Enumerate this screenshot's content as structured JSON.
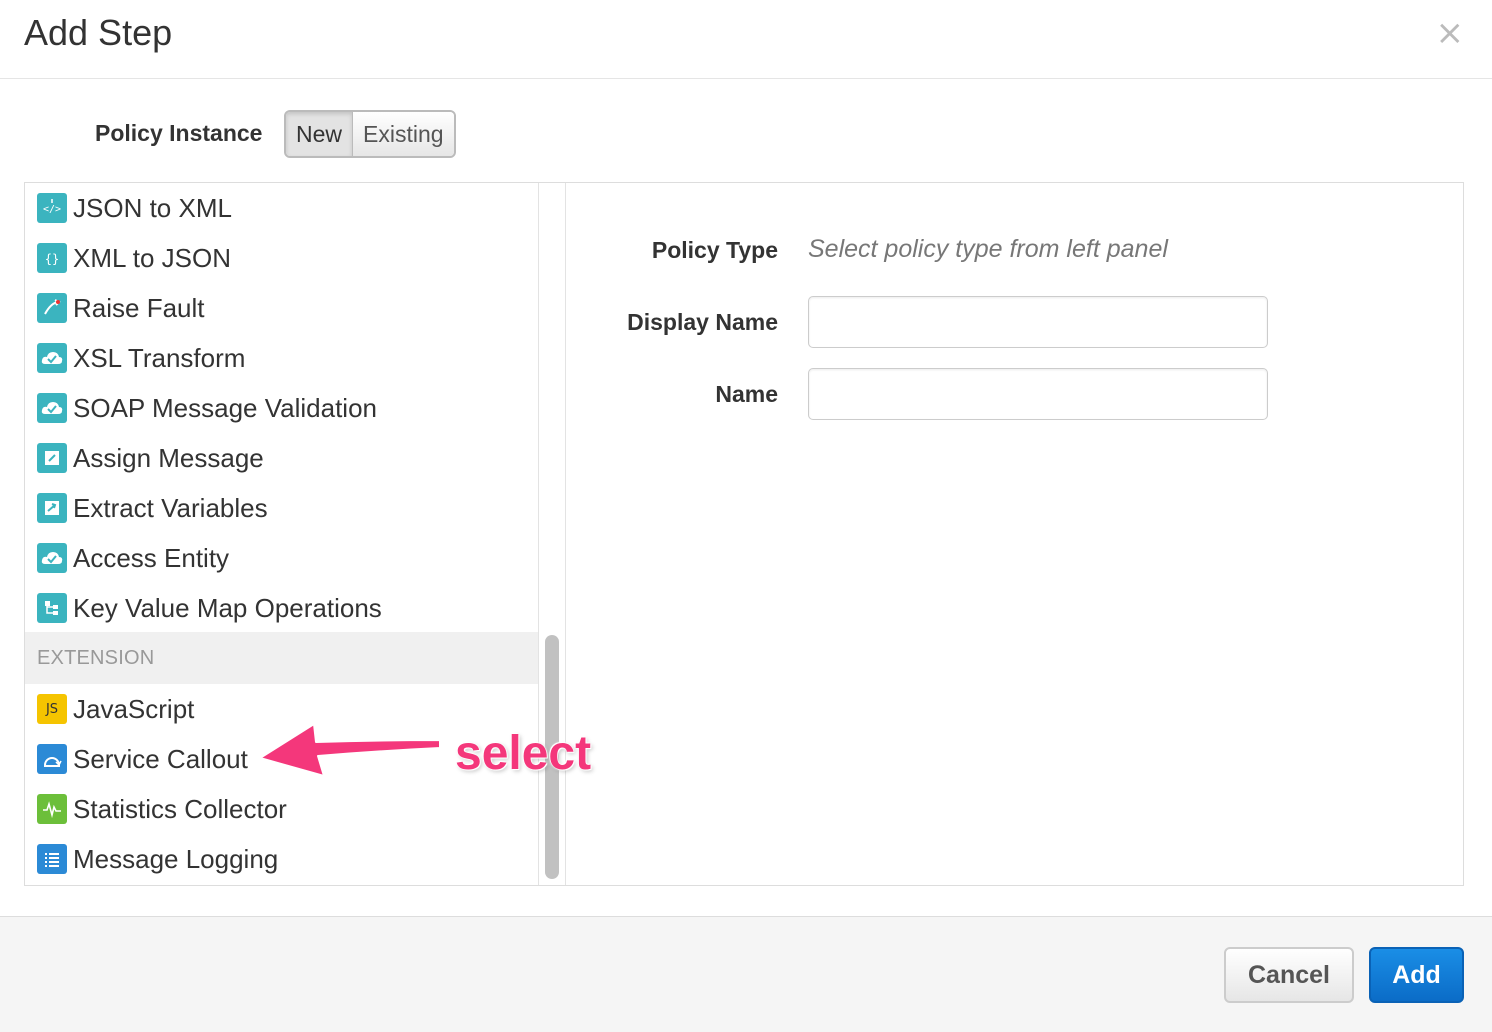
{
  "dialog": {
    "title": "Add Step"
  },
  "policy_instance": {
    "label": "Policy Instance",
    "options": [
      "New",
      "Existing"
    ],
    "selected": "New"
  },
  "policy_list": {
    "items": [
      {
        "label": "JSON to XML",
        "icon": "json-to-xml-icon"
      },
      {
        "label": "XML to JSON",
        "icon": "xml-to-json-icon"
      },
      {
        "label": "Raise Fault",
        "icon": "raise-fault-icon"
      },
      {
        "label": "XSL Transform",
        "icon": "cloud-check-icon"
      },
      {
        "label": "SOAP Message Validation",
        "icon": "cloud-check-icon"
      },
      {
        "label": "Assign Message",
        "icon": "pencil-icon"
      },
      {
        "label": "Extract Variables",
        "icon": "extract-icon"
      },
      {
        "label": "Access Entity",
        "icon": "cloud-check-icon"
      },
      {
        "label": "Key Value Map Operations",
        "icon": "kvm-icon"
      }
    ],
    "section": "EXTENSION",
    "extension_items": [
      {
        "label": "JavaScript",
        "icon": "javascript-icon",
        "icon_text": "JS"
      },
      {
        "label": "Service Callout",
        "icon": "service-callout-icon"
      },
      {
        "label": "Statistics Collector",
        "icon": "statistics-icon"
      },
      {
        "label": "Message Logging",
        "icon": "message-logging-icon"
      }
    ]
  },
  "annotation": {
    "text": "select",
    "color": "#f4377b"
  },
  "form": {
    "policy_type_label": "Policy Type",
    "policy_type_value": "Select policy type from left panel",
    "display_name_label": "Display Name",
    "display_name_value": "",
    "name_label": "Name",
    "name_value": ""
  },
  "footer": {
    "cancel_label": "Cancel",
    "add_label": "Add"
  },
  "colors": {
    "primary": "#0b6cc7",
    "teal_icon": "#3bb4bf",
    "annotation": "#f4377b"
  }
}
